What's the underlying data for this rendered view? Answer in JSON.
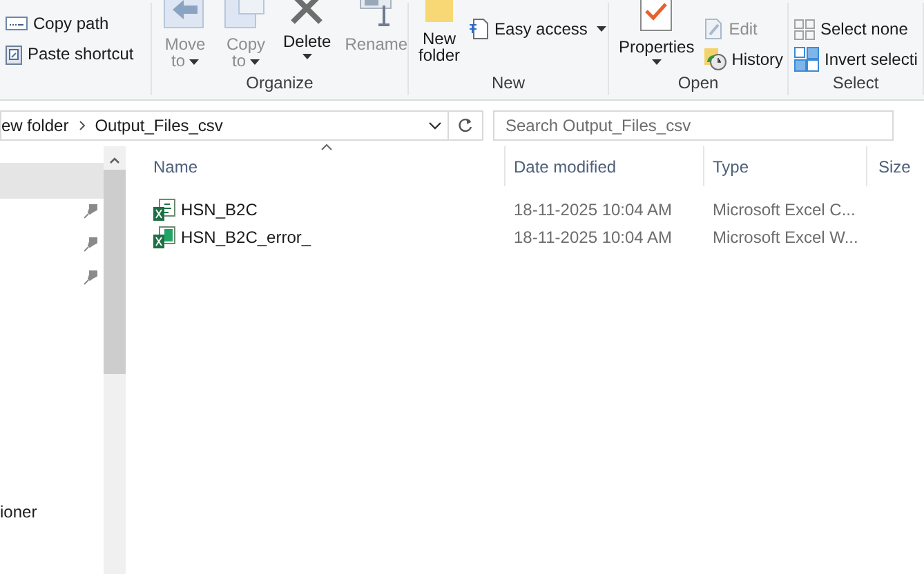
{
  "ribbon": {
    "groups": [
      {
        "items": [
          {
            "kind": "small",
            "label": "Copy path"
          },
          {
            "kind": "small",
            "label": "Paste shortcut"
          }
        ]
      },
      {
        "label": "Organize",
        "items": [
          {
            "kind": "large",
            "label": "Move",
            "label2": "to",
            "dropdown": true,
            "disabled": true
          },
          {
            "kind": "large",
            "label": "Copy",
            "label2": "to",
            "dropdown": true,
            "disabled": true
          },
          {
            "kind": "large",
            "label": "Delete",
            "dropdown": true,
            "disabled": false
          },
          {
            "kind": "large",
            "label": "Rename",
            "dropdown": false,
            "disabled": true
          }
        ]
      },
      {
        "label": "New",
        "items": [
          {
            "kind": "large",
            "label": "New",
            "label2": "folder",
            "dropdown": false,
            "disabled": false
          },
          {
            "kind": "small",
            "label": "Easy access",
            "dropdown": true,
            "disabled": false
          }
        ]
      },
      {
        "label": "Open",
        "items": [
          {
            "kind": "large",
            "label": "Properties",
            "dropdown": true,
            "disabled": false
          },
          {
            "kind": "small",
            "label": "Edit",
            "disabled": true
          },
          {
            "kind": "small",
            "label": "History",
            "disabled": false
          }
        ]
      },
      {
        "label": "Select",
        "items": [
          {
            "kind": "small",
            "label": "Select none"
          },
          {
            "kind": "small",
            "label": "Invert selecti"
          }
        ]
      }
    ]
  },
  "address": {
    "crumbs": [
      "ew folder",
      "Output_Files_csv"
    ]
  },
  "search": {
    "placeholder": "Search Output_Files_csv"
  },
  "nav": {
    "items": [
      {
        "selected": true,
        "pinned": false
      },
      {
        "selected": false,
        "pinned": true
      },
      {
        "selected": false,
        "pinned": true
      },
      {
        "selected": false,
        "pinned": true
      },
      {
        "selected": false,
        "pinned": false,
        "label": "ioner"
      }
    ]
  },
  "table": {
    "columns": [
      "Name",
      "Date modified",
      "Type",
      "Size"
    ],
    "rows": [
      {
        "name": "HSN_B2C",
        "date": "18-11-2025 10:04 AM",
        "type": "Microsoft Excel C...",
        "kind": "csv"
      },
      {
        "name": "HSN_B2C_error_",
        "date": "18-11-2025 10:04 AM",
        "type": "Microsoft Excel W...",
        "kind": "xlsx"
      }
    ]
  }
}
